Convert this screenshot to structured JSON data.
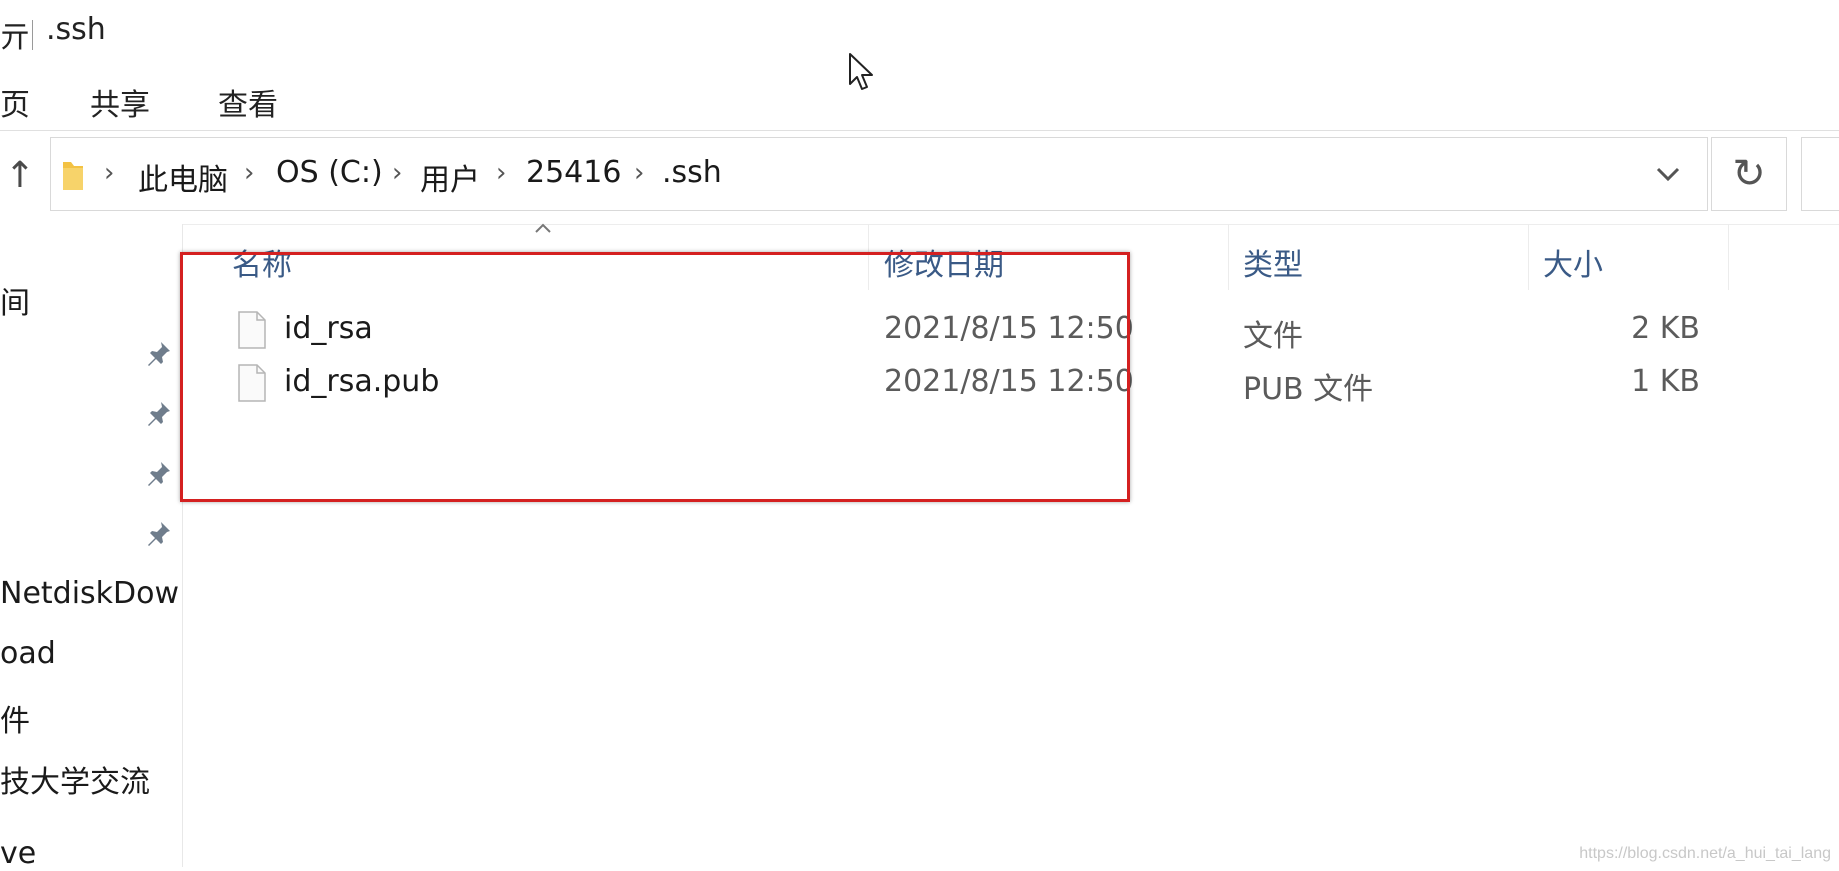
{
  "window": {
    "title_fragment": "亓",
    "title": ".ssh"
  },
  "ribbon": {
    "tabs": [
      "页",
      "共享",
      "查看"
    ]
  },
  "address_bar": {
    "breadcrumbs": [
      "此电脑",
      "OS (C:)",
      "用户",
      "25416",
      ".ssh"
    ]
  },
  "nav_pane": {
    "items": [
      "间",
      "NetdiskDowr",
      "oad",
      "件",
      "技大学交流",
      "ve"
    ],
    "pinned_count": 4
  },
  "file_list": {
    "columns": [
      "名称",
      "修改日期",
      "类型",
      "大小"
    ],
    "rows": [
      {
        "name": "id_rsa",
        "modified": "2021/8/15 12:50",
        "type": "文件",
        "size": "2 KB"
      },
      {
        "name": "id_rsa.pub",
        "modified": "2021/8/15 12:50",
        "type": "PUB 文件",
        "size": "1 KB"
      }
    ]
  },
  "annotation": {
    "highlight_color": "#d42020"
  },
  "watermark": "https://blog.csdn.net/a_hui_tai_lang",
  "colors": {
    "header_text": "#3a5a86",
    "folder": "#f3c243"
  }
}
